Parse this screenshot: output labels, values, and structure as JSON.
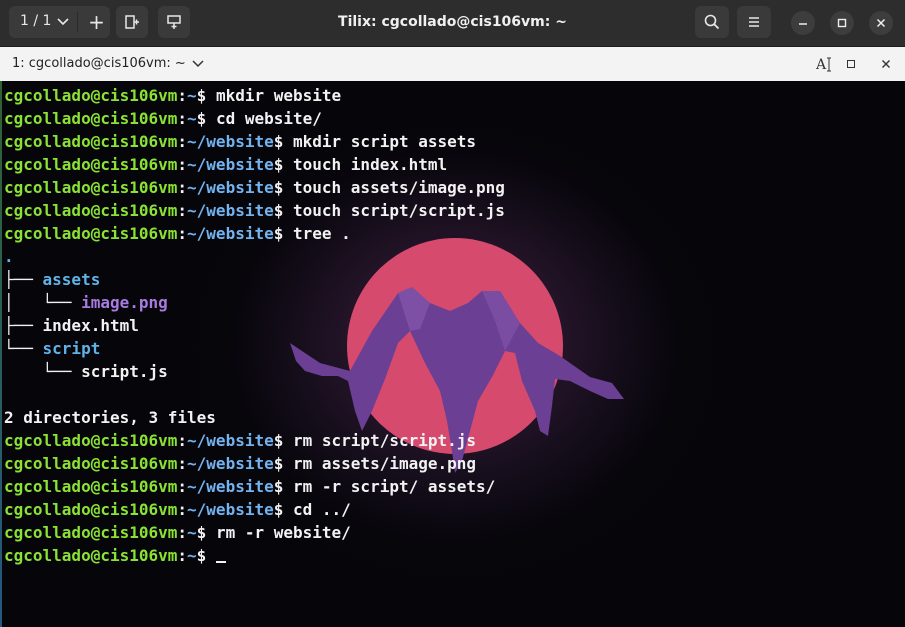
{
  "header": {
    "session_label": "1 / 1",
    "title": "Tilix: cgcollado@cis106vm: ~"
  },
  "tab": {
    "label": "1: cgcollado@cis106vm: ~"
  },
  "terminal": {
    "user": "cgcollado@cis106vm",
    "lines": [
      {
        "path": "~",
        "cmd": "mkdir website"
      },
      {
        "path": "~",
        "cmd": "cd website/"
      },
      {
        "path": "~/website",
        "cmd": "mkdir script assets"
      },
      {
        "path": "~/website",
        "cmd": "touch index.html"
      },
      {
        "path": "~/website",
        "cmd": "touch assets/image.png"
      },
      {
        "path": "~/website",
        "cmd": "touch script/script.js"
      },
      {
        "path": "~/website",
        "cmd": "tree ."
      }
    ],
    "tree": {
      "root": ".",
      "l1": "├── ",
      "assets": "assets",
      "l2": "│   └── ",
      "image": "image.png",
      "l3": "├── ",
      "index": "index.html",
      "l4": "└── ",
      "script": "script",
      "l5": "    └── ",
      "scriptjs": "script.js"
    },
    "summary": "2 directories, 3 files",
    "lines2": [
      {
        "path": "~/website",
        "cmd": "rm script/script.js"
      },
      {
        "path": "~/website",
        "cmd": "rm assets/image.png"
      },
      {
        "path": "~/website",
        "cmd": "rm -r script/ assets/"
      },
      {
        "path": "~/website",
        "cmd": "cd ../"
      },
      {
        "path": "~",
        "cmd": "rm -r website/"
      },
      {
        "path": "~",
        "cmd": ""
      }
    ]
  },
  "colors": {
    "user": "#8ae234",
    "path": "#72b3f0",
    "dir": "#5fb3e8",
    "image_file": "#a77be0",
    "sun": "#d64a6e",
    "mountain": "#6a3f94"
  },
  "icons": [
    "chevron-down-icon",
    "plus-icon",
    "add-terminal-right-icon",
    "add-terminal-down-icon",
    "search-icon",
    "hamburger-menu-icon",
    "minimize-icon",
    "maximize-icon",
    "close-icon",
    "text-cursor-icon",
    "maximize-terminal-icon",
    "close-terminal-icon"
  ]
}
